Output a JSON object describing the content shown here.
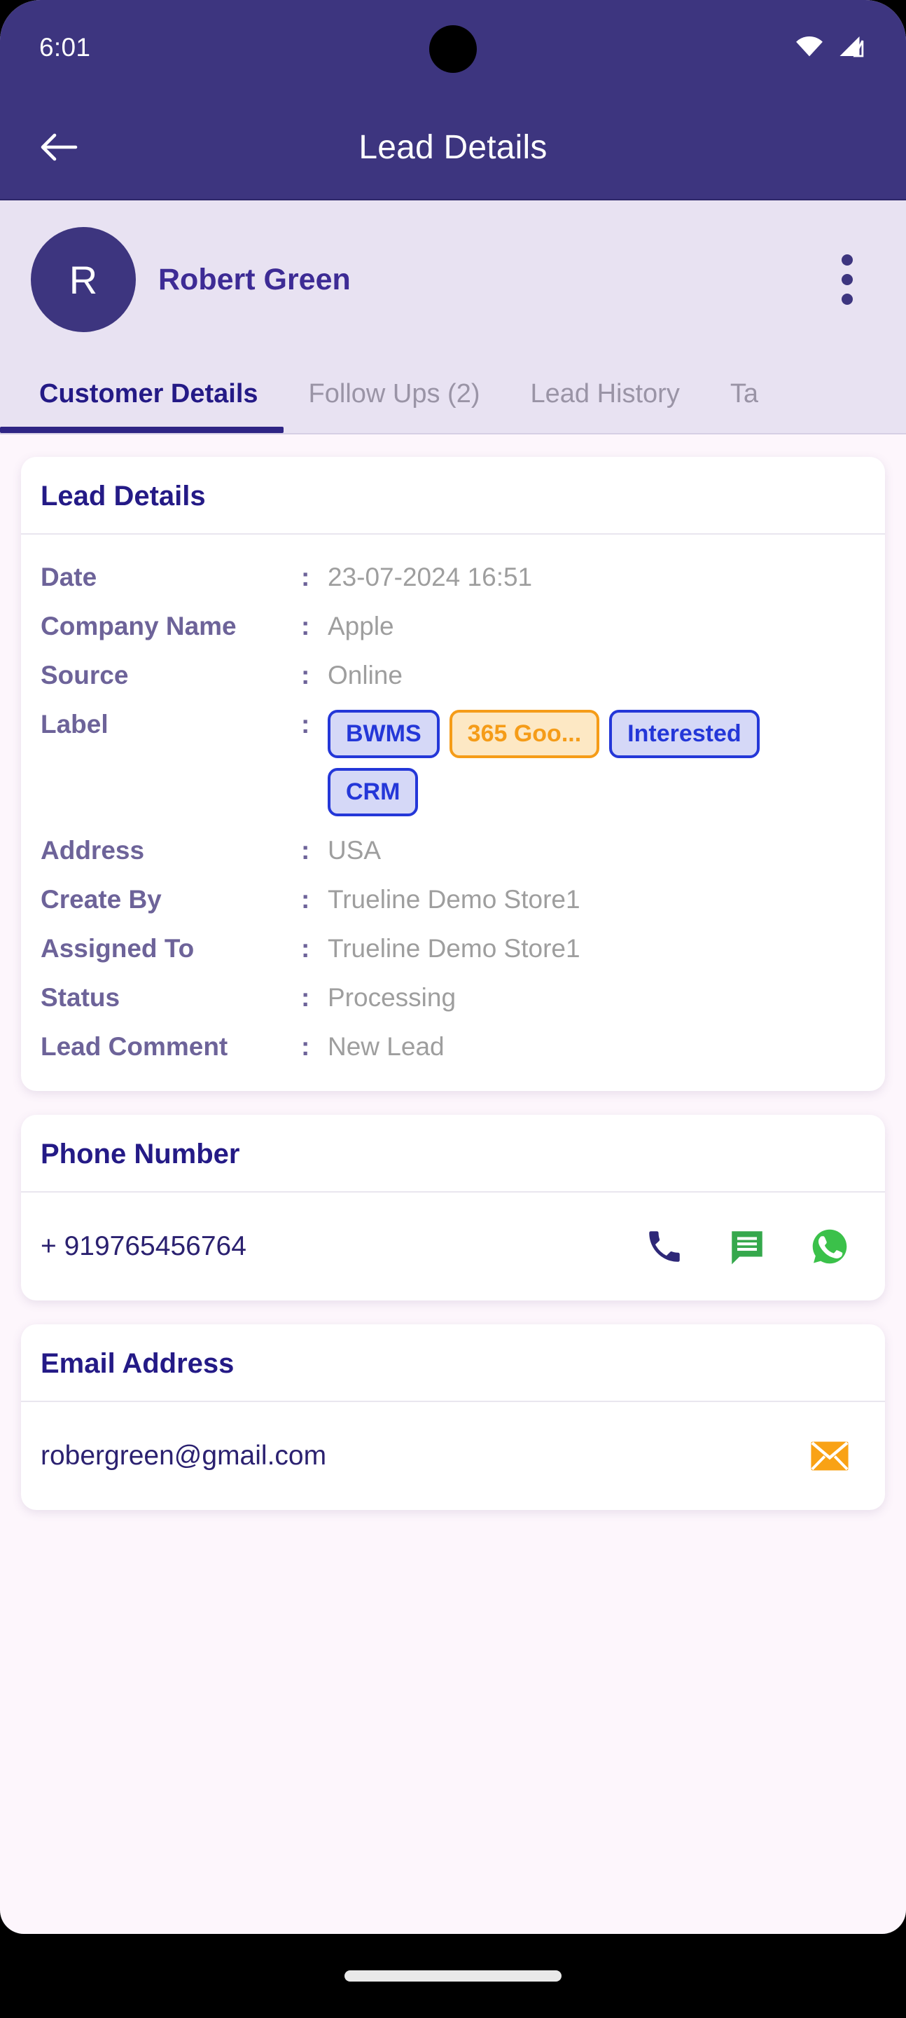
{
  "statusbar": {
    "time": "6:01",
    "wifi_icon": "wifi-icon",
    "signal_icon": "cellular-signal-icon"
  },
  "appbar": {
    "back_icon": "back-arrow-icon",
    "title": "Lead Details"
  },
  "profile": {
    "avatar_initial": "R",
    "name": "Robert Green",
    "menu_icon": "more-vertical-icon"
  },
  "tabs": [
    {
      "label": "Customer Details",
      "active": true
    },
    {
      "label": "Follow Ups (2)",
      "active": false
    },
    {
      "label": "Lead History",
      "active": false
    },
    {
      "label": "Ta",
      "active": false
    }
  ],
  "lead_details": {
    "title": "Lead Details",
    "colon": ":",
    "rows": [
      {
        "label": "Date",
        "value": "23-07-2024 16:51"
      },
      {
        "label": "Company Name",
        "value": "Apple"
      },
      {
        "label": "Source",
        "value": "Online"
      }
    ],
    "label_row": {
      "label": "Label",
      "chips": [
        {
          "text": "BWMS",
          "color": "blue"
        },
        {
          "text": "365 Goo...",
          "color": "orange"
        },
        {
          "text": "Interested",
          "color": "blue"
        },
        {
          "text": "CRM",
          "color": "blue"
        }
      ]
    },
    "rows2": [
      {
        "label": "Address",
        "value": "USA"
      },
      {
        "label": "Create By",
        "value": "Trueline Demo Store1"
      },
      {
        "label": "Assigned To",
        "value": "Trueline Demo Store1"
      },
      {
        "label": "Status",
        "value": "Processing"
      },
      {
        "label": "Lead Comment",
        "value": "New Lead"
      }
    ]
  },
  "phone_card": {
    "title": "Phone Number",
    "value": "+ 919765456764",
    "actions": [
      {
        "icon": "phone-call-icon"
      },
      {
        "icon": "sms-message-icon"
      },
      {
        "icon": "whatsapp-icon"
      }
    ]
  },
  "email_card": {
    "title": "Email Address",
    "value": "robergreen@gmail.com",
    "actions": [
      {
        "icon": "email-envelope-icon"
      }
    ]
  },
  "colors": {
    "primary": "#3d357f",
    "accent": "#241a86",
    "chip_blue": "#2437d8",
    "chip_orange": "#f59c18",
    "page_bg": "#fdf6fc"
  }
}
